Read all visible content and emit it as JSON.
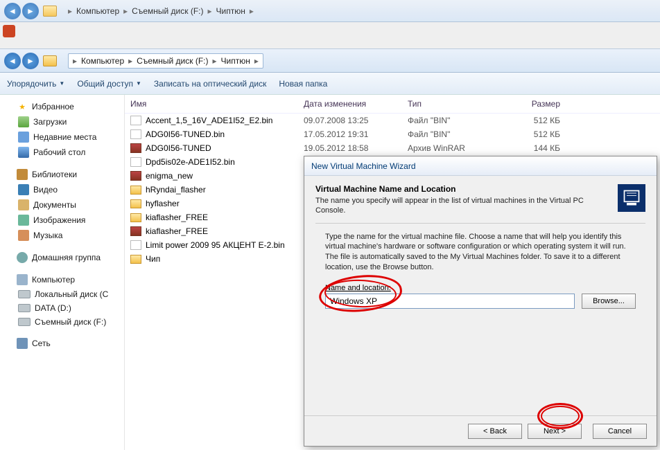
{
  "bg_window": {
    "crumbs": [
      "Компьютер",
      "Съемный диск (F:)",
      "Чиптюн"
    ]
  },
  "fg_window": {
    "crumbs": [
      "Компьютер",
      "Съемный диск (F:)",
      "Чиптюн"
    ],
    "toolbar": {
      "organize": "Упорядочить",
      "share": "Общий доступ",
      "burn": "Записать на оптический диск",
      "newfolder": "Новая папка"
    },
    "columns": {
      "name": "Имя",
      "date": "Дата изменения",
      "type": "Тип",
      "size": "Размер"
    },
    "sidebar": {
      "favorites": "Избранное",
      "fav_items": {
        "downloads": "Загрузки",
        "recent": "Недавние места",
        "desktop": "Рабочий стол"
      },
      "libraries": "Библиотеки",
      "lib_items": {
        "video": "Видео",
        "docs": "Документы",
        "images": "Изображения",
        "music": "Музыка"
      },
      "homegroup": "Домашняя группа",
      "computer": "Компьютер",
      "drives": {
        "c": "Локальный диск (C",
        "d": "DATA (D:)",
        "f": "Съемный диск (F:)"
      },
      "network": "Сеть"
    },
    "files": [
      {
        "name": "Accent_1,5_16V_ADE1I52_E2.bin",
        "date": "09.07.2008 13:25",
        "type": "Файл \"BIN\"",
        "size": "512 КБ",
        "icon": "bin"
      },
      {
        "name": "ADG0I56-TUNED.bin",
        "date": "17.05.2012 19:31",
        "type": "Файл \"BIN\"",
        "size": "512 КБ",
        "icon": "bin"
      },
      {
        "name": "ADG0I56-TUNED",
        "date": "19.05.2012 18:58",
        "type": "Архив WinRAR",
        "size": "144 КБ",
        "icon": "rar"
      },
      {
        "name": "Dpd5is02e-ADE1I52.bin",
        "date": "",
        "type": "",
        "size": "",
        "icon": "bin"
      },
      {
        "name": "enigma_new",
        "date": "",
        "type": "",
        "size": "",
        "icon": "rar"
      },
      {
        "name": "hRyndai_flasher",
        "date": "",
        "type": "",
        "size": "",
        "icon": "fold"
      },
      {
        "name": "hyflasher",
        "date": "",
        "type": "",
        "size": "",
        "icon": "fold"
      },
      {
        "name": "kiaflasher_FREE",
        "date": "",
        "type": "",
        "size": "",
        "icon": "fold"
      },
      {
        "name": "kiaflasher_FREE",
        "date": "",
        "type": "",
        "size": "",
        "icon": "rar"
      },
      {
        "name": "Limit power 2009 95  АКЦЕНТ Е-2.bin",
        "date": "",
        "type": "",
        "size": "",
        "icon": "bin"
      },
      {
        "name": "Чип",
        "date": "",
        "type": "",
        "size": "",
        "icon": "fold"
      }
    ]
  },
  "dialog": {
    "title": "New Virtual Machine Wizard",
    "heading": "Virtual Machine Name and Location",
    "subheading": "The name you specify will appear in the list of virtual machines in the Virtual PC Console.",
    "description": "Type the name for the virtual machine file. Choose a name that will help you identify this virtual machine's hardware or software configuration or which operating system it will run. The file is automatically saved to the My Virtual Machines folder. To save it to a different location, use the Browse button.",
    "field_label": "Name and location:",
    "field_value": "Windows XP",
    "browse": "Browse...",
    "back": "< Back",
    "next": "Next >",
    "cancel": "Cancel"
  }
}
